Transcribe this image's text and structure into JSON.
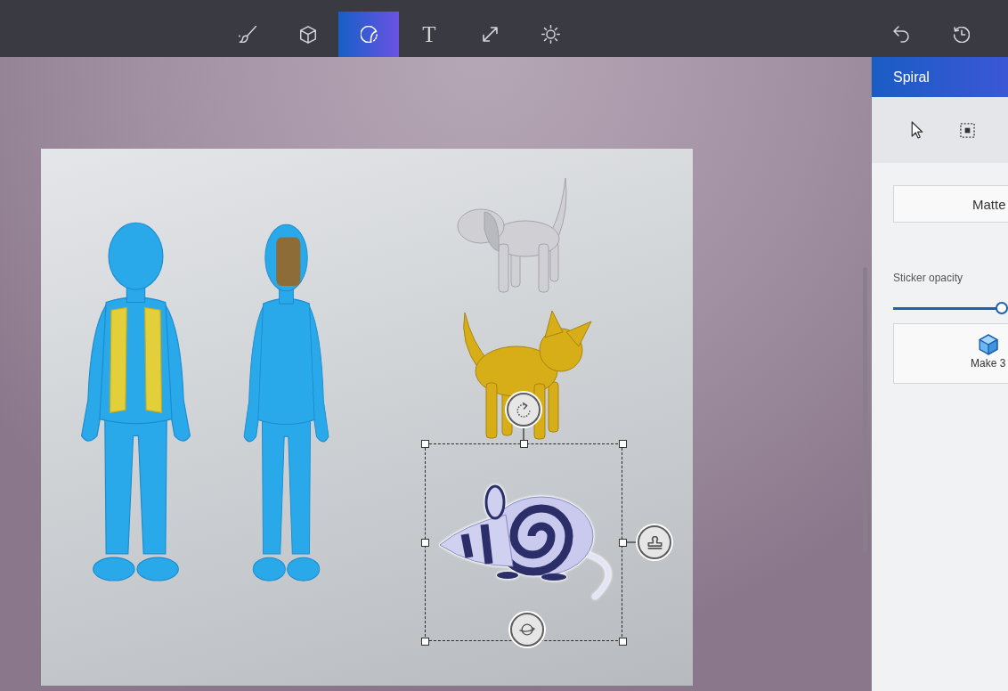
{
  "toolbar": {
    "tools": [
      {
        "kind": "brushes",
        "selected": false
      },
      {
        "kind": "shapes",
        "selected": false
      },
      {
        "kind": "stickers",
        "selected": true
      },
      {
        "kind": "text",
        "glyph": "T",
        "selected": false
      },
      {
        "kind": "canvas",
        "selected": false
      },
      {
        "kind": "effects",
        "selected": false
      }
    ],
    "actions": [
      {
        "kind": "undo"
      },
      {
        "kind": "history"
      }
    ]
  },
  "canvas": {
    "models": [
      {
        "kind": "avatar",
        "vest": true,
        "selected": false
      },
      {
        "kind": "avatar",
        "sticker": true,
        "selected": false
      },
      {
        "kind": "dog",
        "selected": false
      },
      {
        "kind": "cat",
        "selected": false
      },
      {
        "kind": "rat",
        "selected": true
      }
    ]
  },
  "panel": {
    "title": "Spiral",
    "tools": [
      {
        "kind": "select",
        "selected": false
      },
      {
        "kind": "marquee",
        "selected": false
      }
    ],
    "finish": {
      "label": "Matte"
    },
    "opacity": {
      "label": "Sticker opacity",
      "level": 1
    },
    "make_3d": {
      "label": "Make 3"
    }
  }
}
